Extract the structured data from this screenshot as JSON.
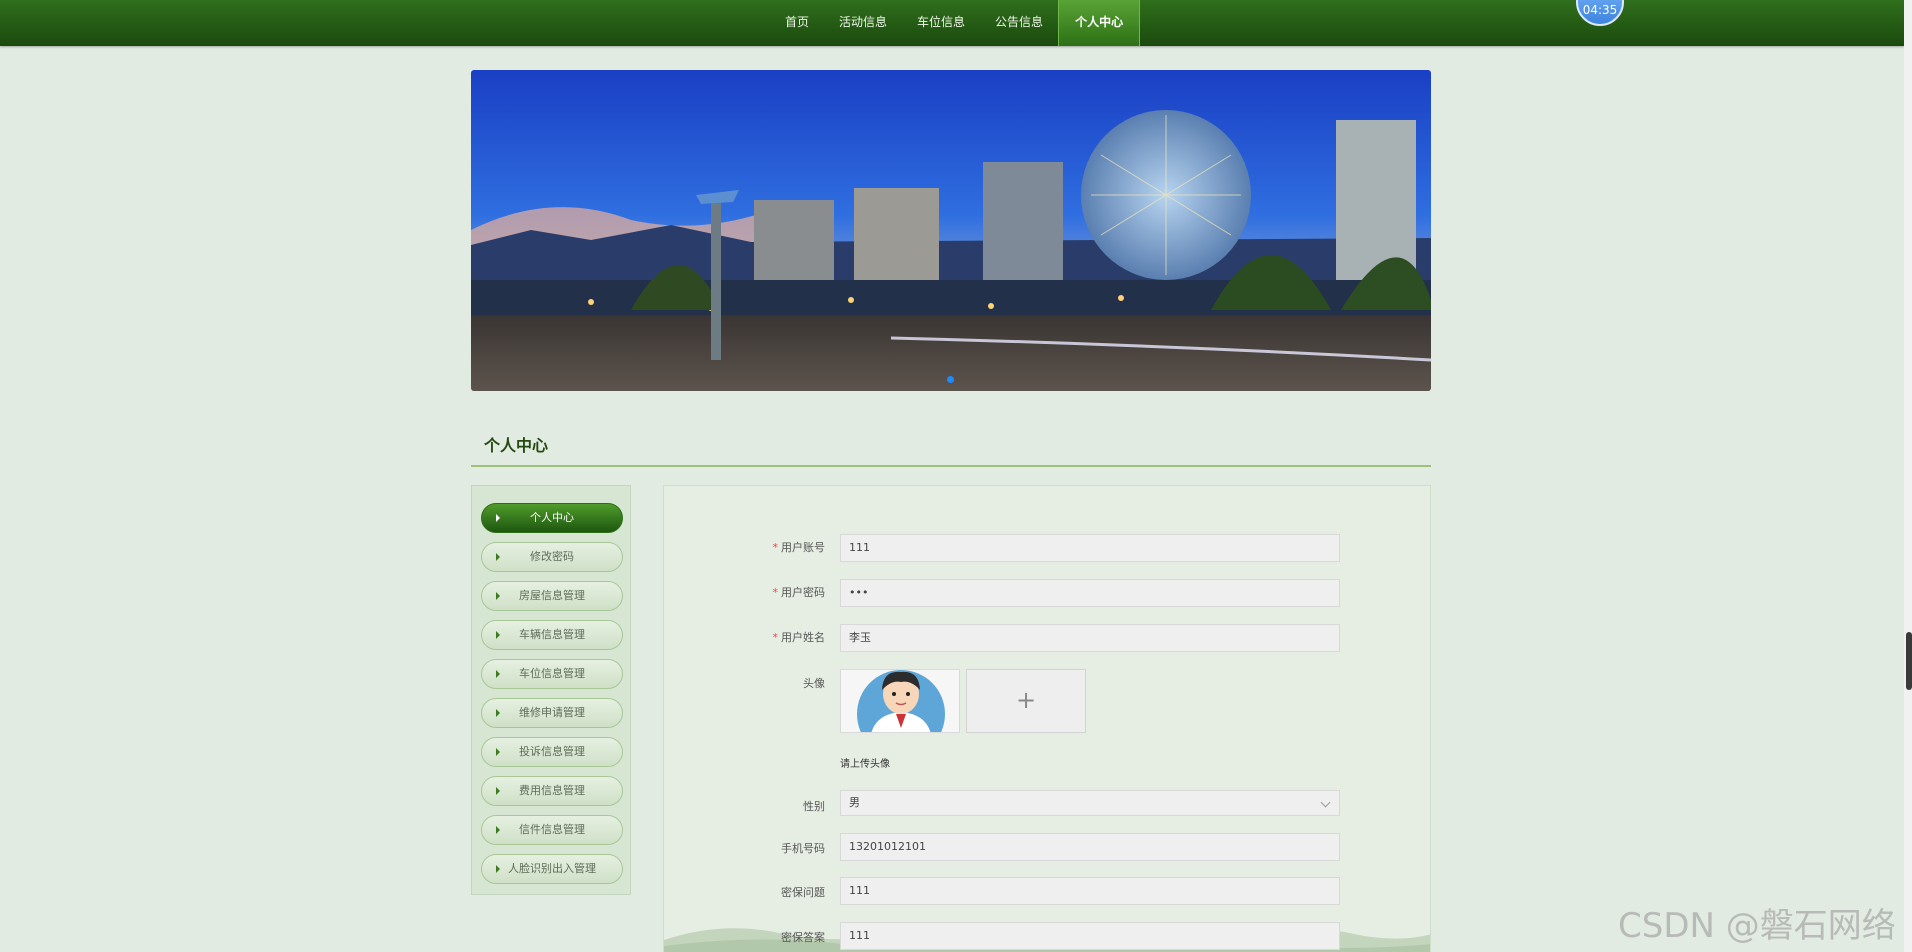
{
  "nav": {
    "items": [
      "首页",
      "活动信息",
      "车位信息",
      "公告信息",
      "个人中心"
    ],
    "active_index": 4
  },
  "clock": {
    "time": "04:35"
  },
  "banner": {
    "slide_count": 1,
    "active_slide": 0
  },
  "section": {
    "title": "个人中心"
  },
  "sidebar": {
    "items": [
      "个人中心",
      "修改密码",
      "房屋信息管理",
      "车辆信息管理",
      "车位信息管理",
      "维修申请管理",
      "投诉信息管理",
      "费用信息管理",
      "信件信息管理",
      "人脸识别出入管理"
    ],
    "active_index": 0
  },
  "form": {
    "account": {
      "label": "用户账号",
      "value": "111",
      "required": true
    },
    "password": {
      "label": "用户密码",
      "value": "•••",
      "required": true
    },
    "name": {
      "label": "用户姓名",
      "value": "李玉",
      "required": true
    },
    "avatar": {
      "label": "头像",
      "hint": "请上传头像",
      "add_icon": "plus-icon"
    },
    "gender": {
      "label": "性别",
      "value": "男"
    },
    "phone": {
      "label": "手机号码",
      "value": "13201012101"
    },
    "security_question": {
      "label": "密保问题",
      "value": "111"
    },
    "security_answer": {
      "label": "密保答案",
      "value": "111"
    }
  },
  "watermark": {
    "text": "CSDN @磐石网络"
  },
  "colors": {
    "nav": "#1b4a0e",
    "accent": "#2d7015",
    "background": "#e2ebe1"
  }
}
